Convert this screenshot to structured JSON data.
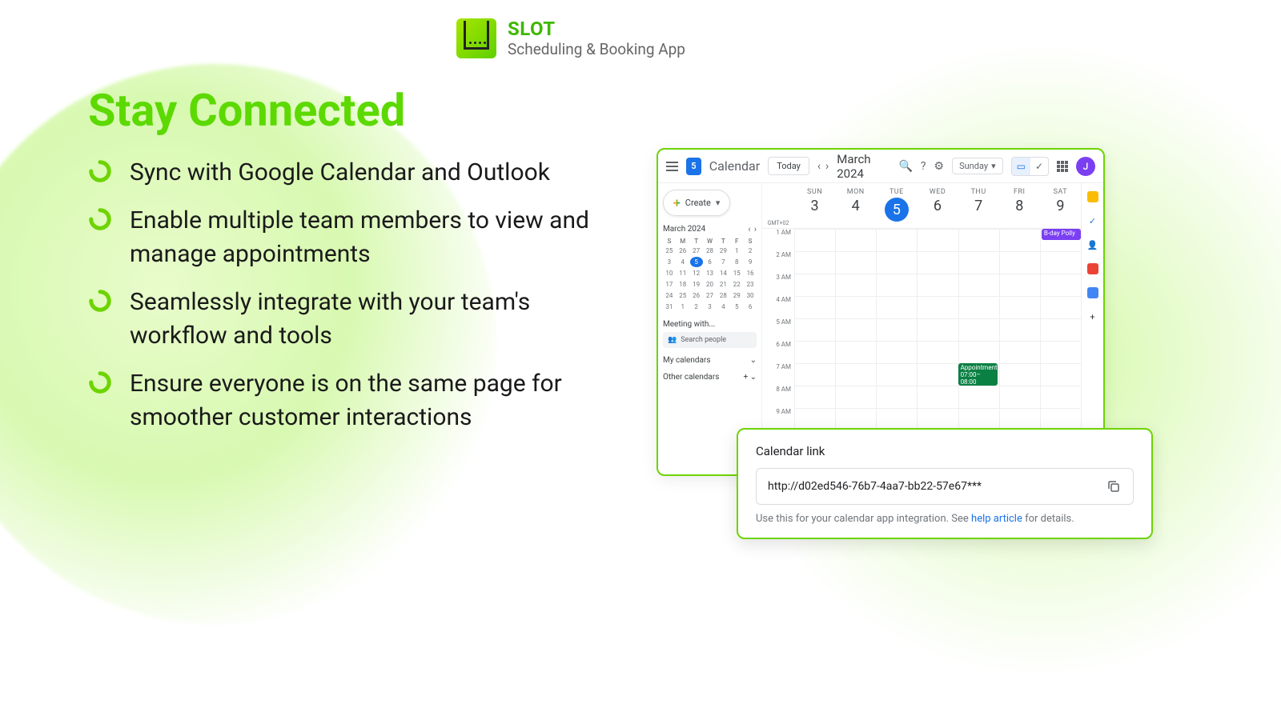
{
  "brand": {
    "name": "SLOT",
    "sub": "Scheduling & Booking App"
  },
  "title": "Stay Connected",
  "features": [
    "Sync with Google Calendar and Outlook",
    "Enable multiple team members to view and manage appointments",
    "Seamlessly integrate with your team's workflow and tools",
    "Ensure everyone is on the same page for smoother customer interactions"
  ],
  "calendar": {
    "app_label": "Calendar",
    "today_btn": "Today",
    "month": "March 2024",
    "view_selector": "Sunday",
    "avatar_letter": "J",
    "create_btn": "Create",
    "mini_month": "March 2024",
    "day_headers": [
      "S",
      "M",
      "T",
      "W",
      "T",
      "F",
      "S"
    ],
    "mini_days": [
      "25",
      "26",
      "27",
      "28",
      "29",
      "1",
      "2",
      "3",
      "4",
      "5",
      "6",
      "7",
      "8",
      "9",
      "10",
      "11",
      "12",
      "13",
      "14",
      "15",
      "16",
      "17",
      "18",
      "19",
      "20",
      "21",
      "22",
      "23",
      "24",
      "25",
      "26",
      "27",
      "28",
      "29",
      "30",
      "31",
      "1",
      "2",
      "3",
      "4",
      "5",
      "6"
    ],
    "mini_selected_day": "5",
    "meeting_with": "Meeting with...",
    "search_people": "Search people",
    "my_calendars": "My calendars",
    "other_calendars": "Other calendars",
    "tz": "GMT+02",
    "days": [
      {
        "dn": "SUN",
        "num": "3"
      },
      {
        "dn": "MON",
        "num": "4"
      },
      {
        "dn": "TUE",
        "num": "5",
        "sel": true
      },
      {
        "dn": "WED",
        "num": "6"
      },
      {
        "dn": "THU",
        "num": "7"
      },
      {
        "dn": "FRI",
        "num": "8"
      },
      {
        "dn": "SAT",
        "num": "9"
      }
    ],
    "hours": [
      "1 AM",
      "2 AM",
      "3 AM",
      "4 AM",
      "5 AM",
      "6 AM",
      "7 AM",
      "8 AM",
      "9 AM"
    ],
    "bday_event": "B-day Polly",
    "appt_event_title": "Appointment",
    "appt_event_time": "07:00–08:00"
  },
  "link_card": {
    "title": "Calendar link",
    "url": "http://d02ed546-76b7-4aa7-bb22-57e67***",
    "hint_pre": "Use this for your calendar app integration. See ",
    "hint_link": "help article",
    "hint_post": " for details."
  }
}
